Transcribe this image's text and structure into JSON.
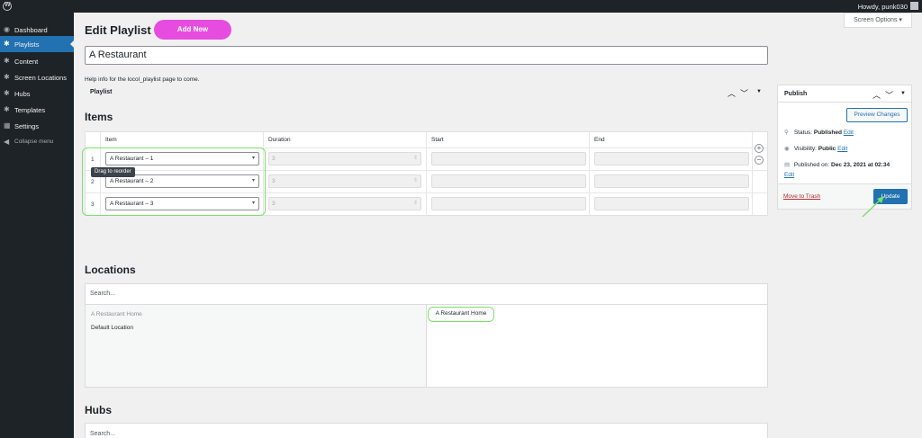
{
  "adminbar": {
    "greeting": "Howdy, punk030"
  },
  "sidebar": {
    "items": [
      {
        "label": "Dashboard",
        "icon": "◉"
      },
      {
        "label": "Playlists",
        "icon": "✱"
      },
      {
        "label": "Content",
        "icon": "✱"
      },
      {
        "label": "Screen Locations",
        "icon": "✱"
      },
      {
        "label": "Hubs",
        "icon": "✱"
      },
      {
        "label": "Templates",
        "icon": "✱"
      },
      {
        "label": "Settings",
        "icon": "▦"
      }
    ],
    "collapse": {
      "label": "Collapse menu",
      "icon": "◀"
    }
  },
  "header": {
    "title": "Edit Playlist",
    "add_new": "Add New",
    "screen_options": "Screen Options ▾"
  },
  "post": {
    "title_value": "A Restaurant",
    "help_text": "Help info for the locol_playlist page to come.",
    "metabox_title": "Playlist"
  },
  "items": {
    "heading": "Items",
    "columns": [
      "Item",
      "Duration",
      "Start",
      "End"
    ],
    "rows": [
      {
        "num": "1",
        "item": "A Restaurant – 1",
        "duration": "3"
      },
      {
        "num": "2",
        "item": "A Restaurant – 2",
        "duration": "3"
      },
      {
        "num": "3",
        "item": "A Restaurant – 3",
        "duration": "3"
      }
    ],
    "tooltip": "Drag to reorder",
    "add": "+",
    "remove": "−"
  },
  "locations": {
    "heading": "Locations",
    "search_placeholder": "Search...",
    "options": [
      "A Restaurant Home",
      "Default Location"
    ],
    "selected": "A Restaurant Home"
  },
  "hubs": {
    "heading": "Hubs",
    "search_placeholder": "Search..."
  },
  "publish": {
    "title": "Publish",
    "preview": "Preview Changes",
    "status_label": "Status:",
    "status_value": "Published",
    "visibility_label": "Visibility:",
    "visibility_value": "Public",
    "published_label": "Published on:",
    "published_value": "Dec 23, 2021 at 02:34",
    "edit": "Edit",
    "trash": "Move to Trash",
    "update": "Update"
  },
  "colors": {
    "accent": "#2271b1",
    "add_new": "#e74ce0",
    "highlight": "#7be06c",
    "sidebar": "#1d2327"
  }
}
